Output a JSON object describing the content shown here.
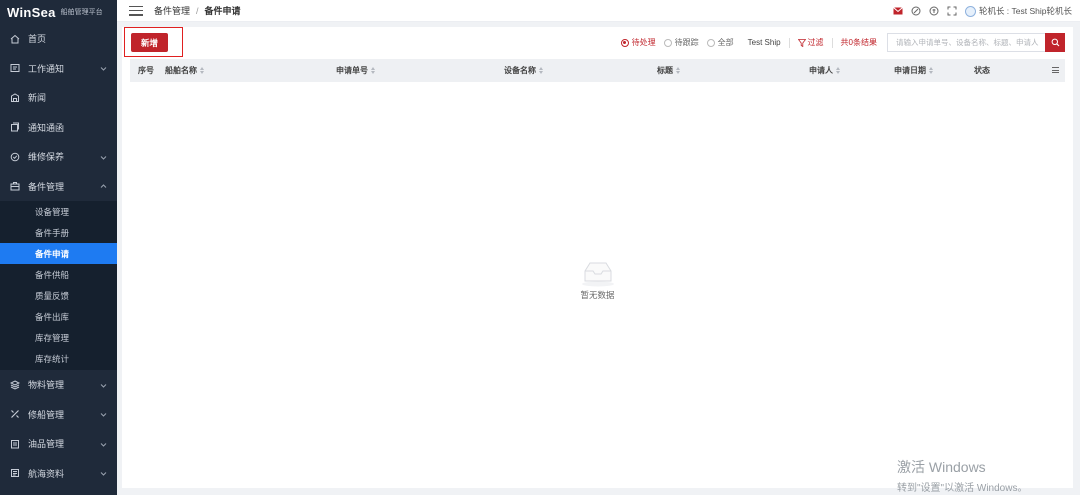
{
  "app": {
    "brand": "WinSea",
    "brand_sub": "船舶管理平台"
  },
  "sidebar": {
    "items": [
      {
        "label": "首页",
        "icon": "home-icon",
        "has_arrow": false
      },
      {
        "label": "工作通知",
        "icon": "notice-icon",
        "has_arrow": true
      },
      {
        "label": "新闻",
        "icon": "news-icon",
        "has_arrow": false
      },
      {
        "label": "通知通函",
        "icon": "circular-icon",
        "has_arrow": false
      },
      {
        "label": "维修保养",
        "icon": "maintenance-icon",
        "has_arrow": true
      },
      {
        "label": "备件管理",
        "icon": "spareparts-icon",
        "has_arrow": true,
        "expanded": true
      },
      {
        "label": "物料管理",
        "icon": "material-icon",
        "has_arrow": true
      },
      {
        "label": "修船管理",
        "icon": "repair-icon",
        "has_arrow": true
      },
      {
        "label": "油品管理",
        "icon": "oil-icon",
        "has_arrow": true
      },
      {
        "label": "航海资料",
        "icon": "nautical-icon",
        "has_arrow": true
      }
    ],
    "submenu": [
      {
        "label": "设备管理",
        "active": false
      },
      {
        "label": "备件手册",
        "active": false
      },
      {
        "label": "备件申请",
        "active": true
      },
      {
        "label": "备件供船",
        "active": false
      },
      {
        "label": "质量反馈",
        "active": false
      },
      {
        "label": "备件出库",
        "active": false
      },
      {
        "label": "库存管理",
        "active": false
      },
      {
        "label": "库存统计",
        "active": false
      }
    ]
  },
  "header": {
    "breadcrumb": [
      "备件管理",
      "备件申请"
    ],
    "separator": "/",
    "user": "轮机长 : Test Ship轮机长"
  },
  "toolbar": {
    "new_label": "新增",
    "radios": [
      {
        "label": "待处理",
        "checked": true
      },
      {
        "label": "待跟踪",
        "checked": false
      },
      {
        "label": "全部",
        "checked": false
      }
    ],
    "ship": "Test Ship",
    "filter_label": "过滤",
    "count": "共0条结果",
    "search_placeholder": "请输入申请单号、设备名称、标题、申请人"
  },
  "table": {
    "columns": [
      "序号",
      "船舶名称",
      "申请单号",
      "设备名称",
      "标题",
      "申请人",
      "申请日期",
      "状态"
    ],
    "rows": [],
    "empty_text": "暂无数据"
  },
  "watermark": {
    "title": "激活 Windows",
    "subtitle": "转到\"设置\"以激活 Windows。"
  },
  "colors": {
    "sidebar_bg": "#1f2a3a",
    "accent": "#c0242b",
    "active_menu": "#1e7bf2"
  }
}
